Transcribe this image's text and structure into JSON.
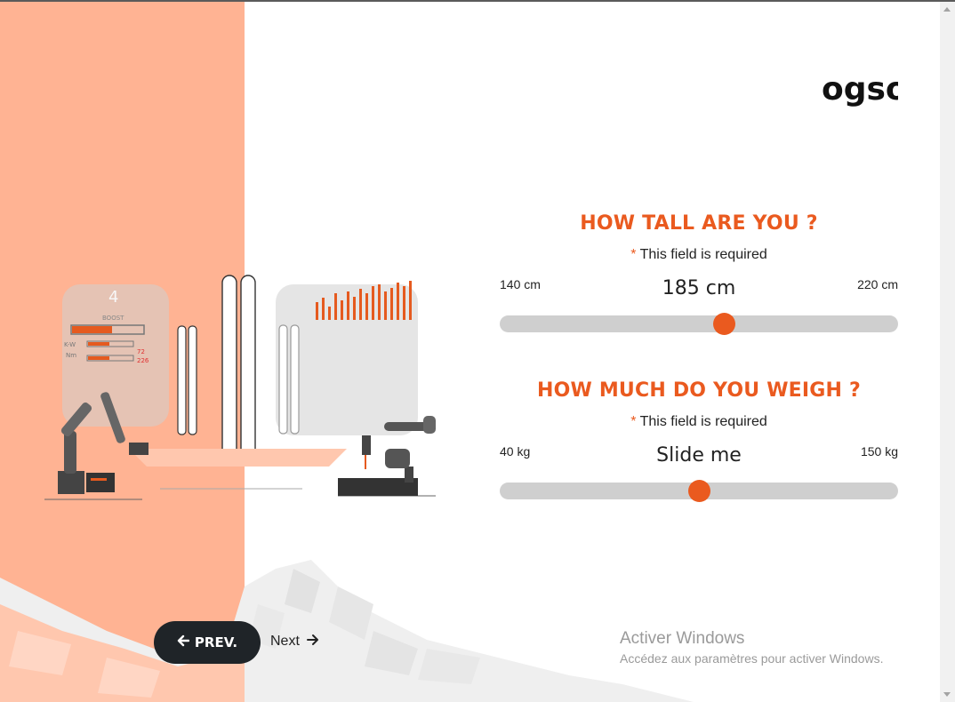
{
  "brand": {
    "logo_text": "ogso"
  },
  "height_question": {
    "title": "HOW TALL ARE YOU ?",
    "required_star": "*",
    "required_text": "This field is required",
    "min_label": "140 cm",
    "max_label": "220 cm",
    "value_display": "185 cm",
    "min": 140,
    "max": 220,
    "value": 185
  },
  "weight_question": {
    "title": "HOW MUCH DO YOU WEIGH ?",
    "required_star": "*",
    "required_text": "This field is required",
    "min_label": "40 kg",
    "max_label": "150 kg",
    "value_display": "Slide me",
    "min": 40,
    "max": 150,
    "value": 95
  },
  "nav": {
    "prev_label": "PREV.",
    "next_label": "Next"
  },
  "illustration": {
    "gauge_number": "4",
    "gauge_label": "BOOST",
    "row_labels": [
      "K-W",
      "Nm"
    ],
    "row_values": [
      "72",
      "226"
    ]
  },
  "watermark": {
    "title": "Activer Windows",
    "subtitle": "Accédez aux paramètres pour activer Windows."
  },
  "colors": {
    "accent": "#ea5a1f",
    "left_panel": "#ffb393",
    "button_dark": "#1f2428",
    "track": "#cfcfcf"
  }
}
